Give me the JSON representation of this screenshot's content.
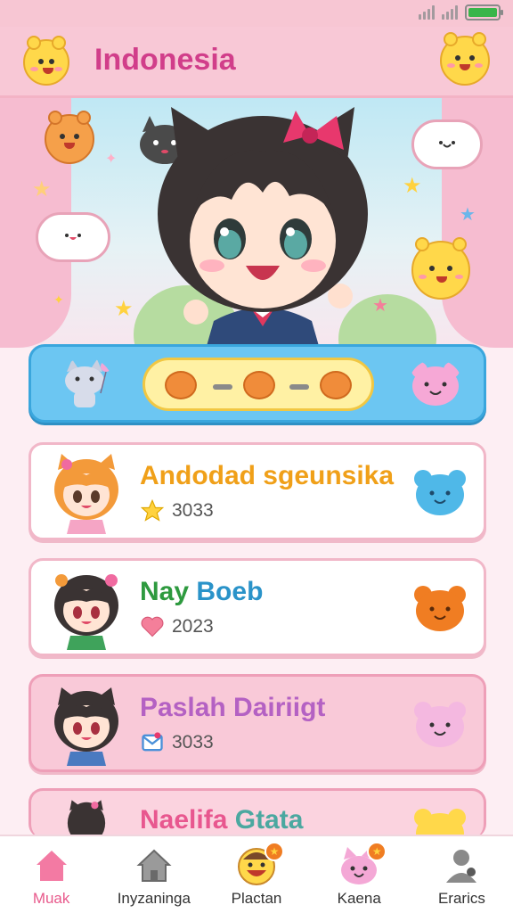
{
  "status_bar": {
    "battery_level": 1.0,
    "battery_color": "#39b54a"
  },
  "header": {
    "title": "Indonesia",
    "title_color": "#d13e8a",
    "left_icon": "bear-face-icon",
    "right_icon": "bear-face-icon"
  },
  "hero": {
    "character": "anime-girl-with-bow",
    "decorations": [
      "cloud-face-icon",
      "star-icon",
      "cat-icon",
      "bear-face-icon"
    ]
  },
  "highlight": {
    "left_icon": "cat-with-balloon-icon",
    "center_icons": [
      "bear-face-icon",
      "bear-face-icon",
      "bear-face-icon"
    ],
    "right_icon": "pink-bear-icon"
  },
  "list": [
    {
      "title": "Andodad sgeunsika",
      "title_color": "#f0a019",
      "meta_icon": "star-icon",
      "meta_value": "3033",
      "buddy_icon": "blue-bear-icon",
      "buddy_color": "#4fb8e8",
      "style": "white",
      "avatar_hair": "#f39a3a"
    },
    {
      "title_part1": "Nay",
      "title_part2": "Boeb",
      "title_colors": [
        "#2e9a3f",
        "#2a93c9"
      ],
      "meta_icon": "heart-icon",
      "meta_value": "2023",
      "buddy_icon": "orange-bear-icon",
      "buddy_color": "#f07d22",
      "style": "white",
      "avatar_hair": "#3a3333"
    },
    {
      "title": "Paslah Dairiigt",
      "title_color": "#b461c3",
      "meta_icon": "mail-icon",
      "meta_value": "3033",
      "buddy_icon": "pink-bear-icon",
      "buddy_color": "#f4b8e0",
      "style": "pink",
      "avatar_hair": "#3a3333"
    },
    {
      "title_part1": "Naelifa",
      "title_part2": "Gtata",
      "title_colors": [
        "#e8578f",
        "#4ba8a0"
      ],
      "buddy_icon": "yellow-bear-icon",
      "buddy_color": "#ffd84a",
      "style": "pink",
      "avatar_hair": "#3a3333"
    }
  ],
  "nav": [
    {
      "label": "Muak",
      "icon": "home-icon",
      "active": true
    },
    {
      "label": "Inyzaninga",
      "icon": "house-icon",
      "active": false
    },
    {
      "label": "Plactan",
      "icon": "smile-face-icon",
      "active": false,
      "badge": true
    },
    {
      "label": "Kaena",
      "icon": "pink-cat-icon",
      "active": false,
      "badge": true
    },
    {
      "label": "Erarics",
      "icon": "profile-icon",
      "active": false
    }
  ]
}
